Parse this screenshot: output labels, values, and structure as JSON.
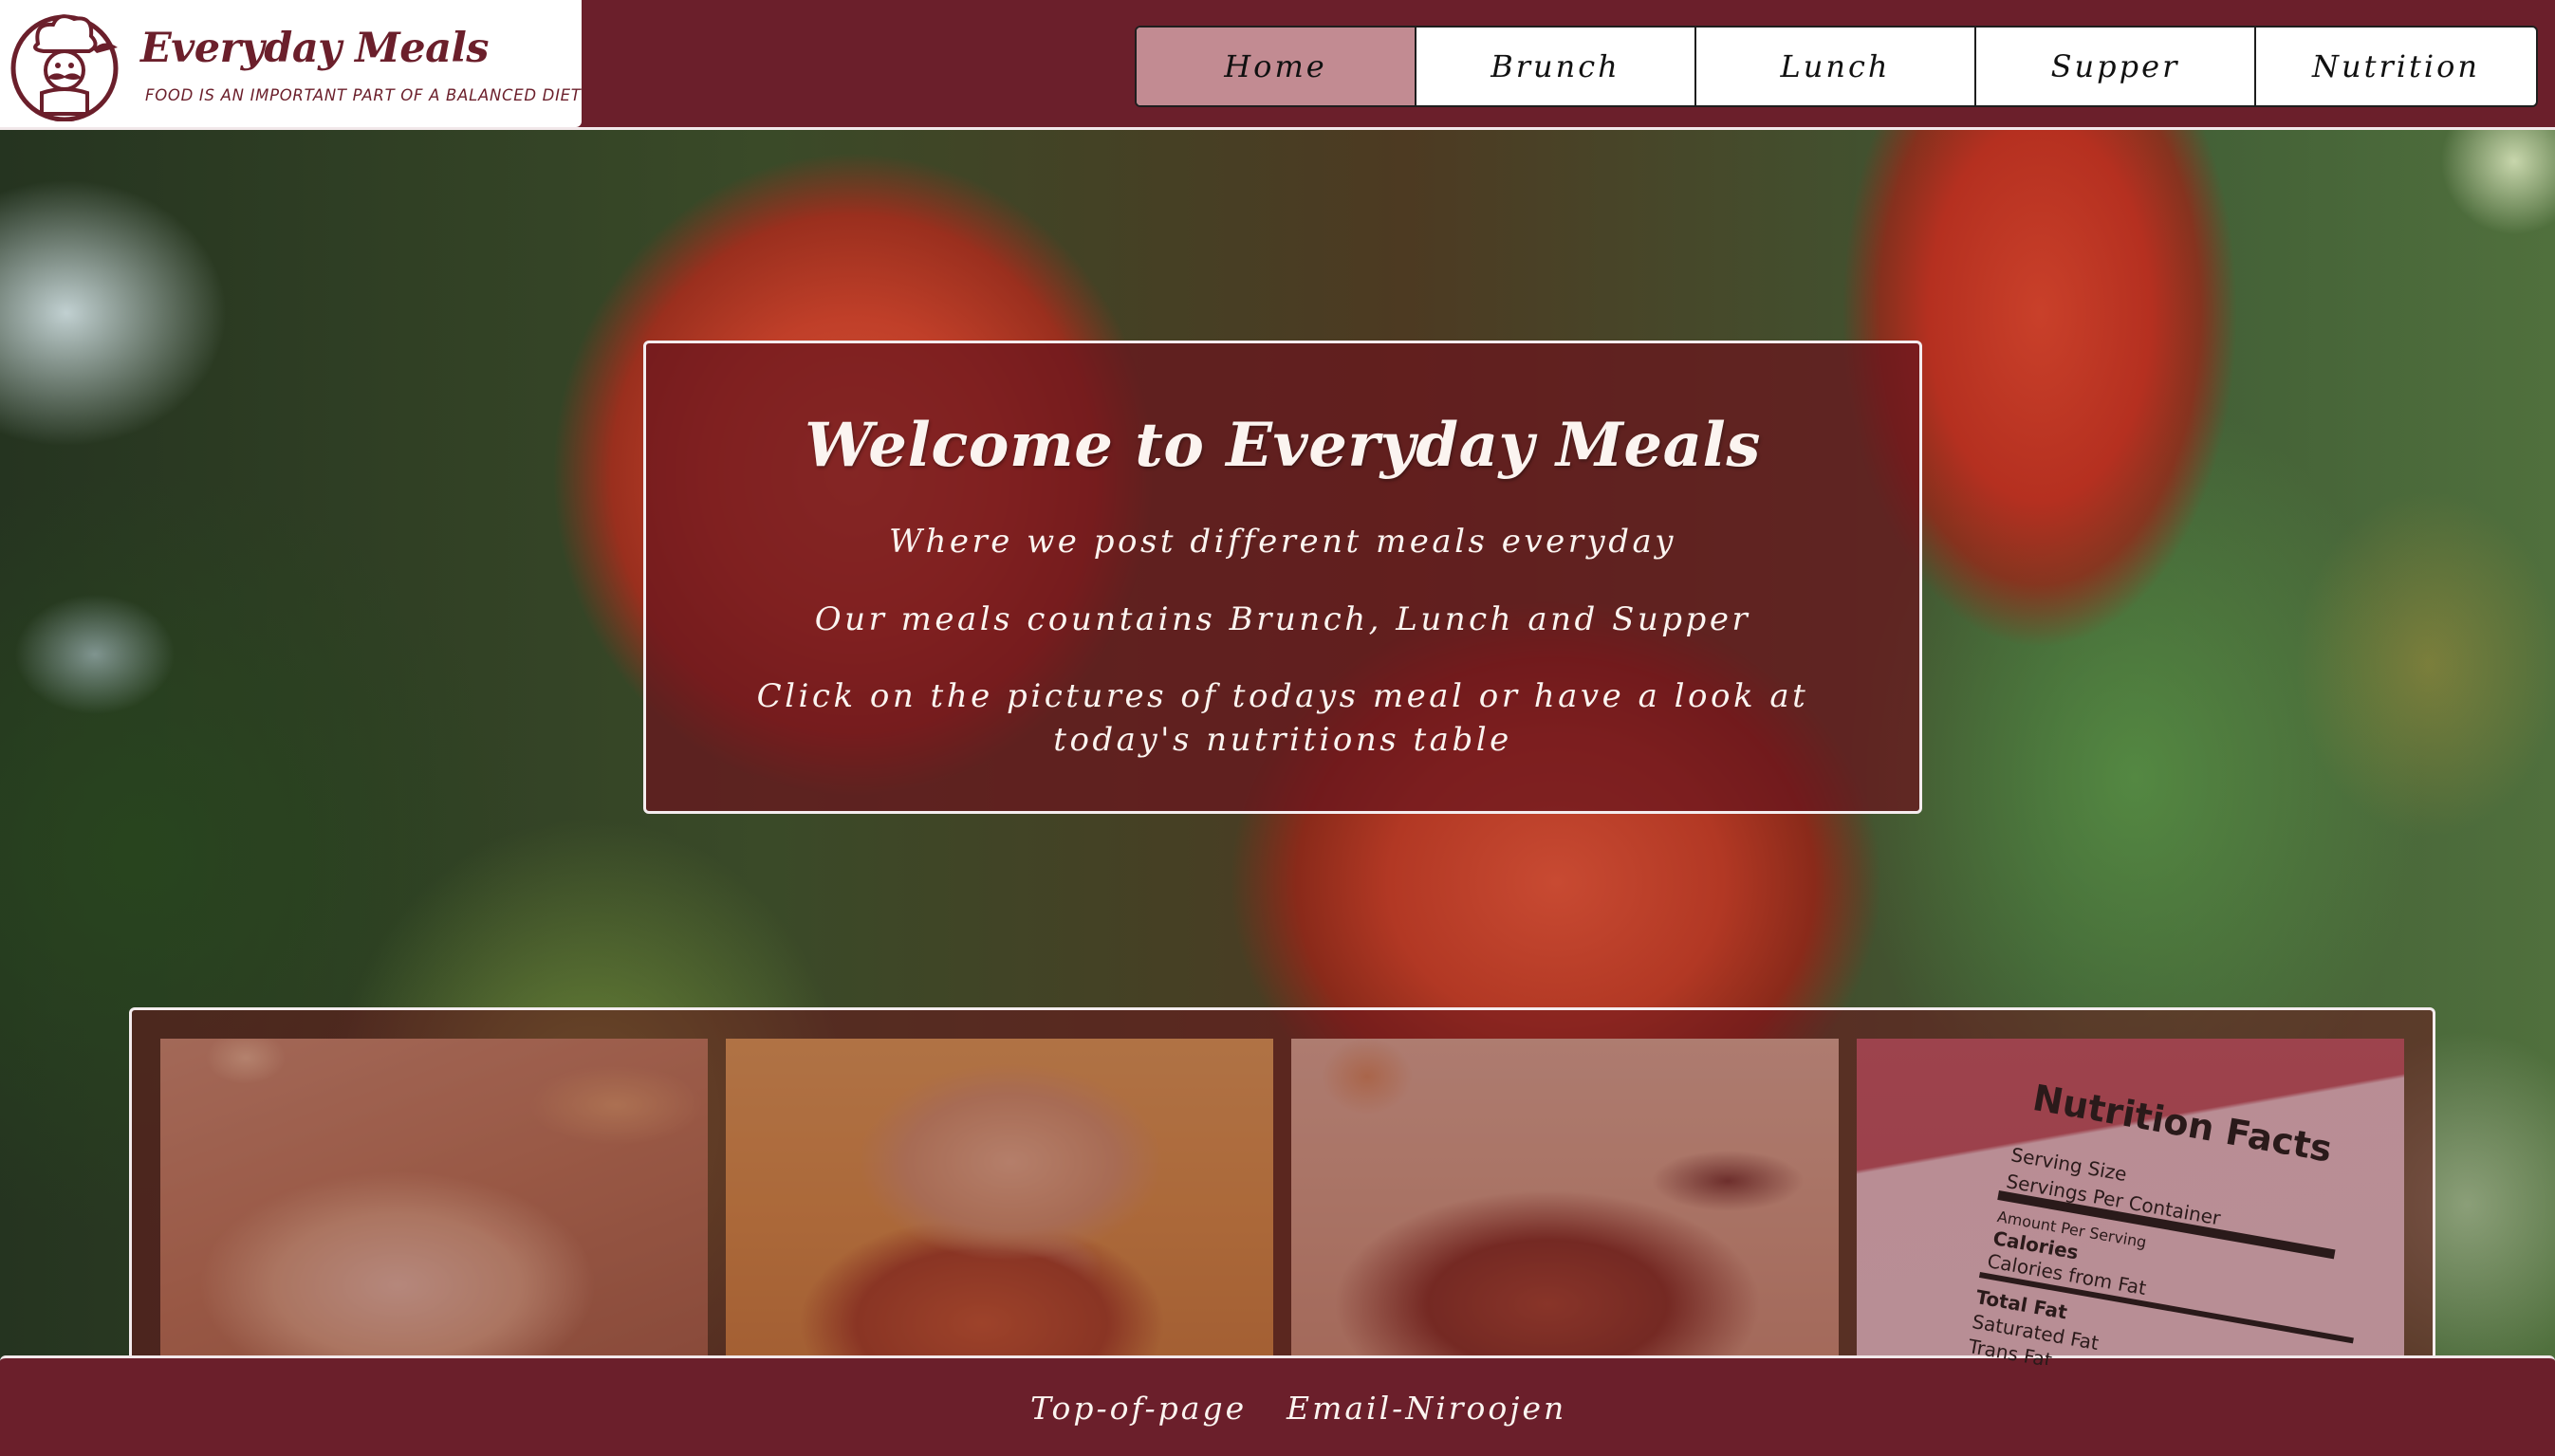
{
  "brand": {
    "name": "Everyday Meals",
    "tagline": "FOOD IS AN IMPORTANT PART OF A BALANCED DIET",
    "logo_icon": "chef-icon",
    "color": "#6b1f2b"
  },
  "nav": {
    "items": [
      {
        "label": "Home",
        "active": true
      },
      {
        "label": "Brunch",
        "active": false
      },
      {
        "label": "Lunch",
        "active": false
      },
      {
        "label": "Supper",
        "active": false
      },
      {
        "label": "Nutrition",
        "active": false
      }
    ],
    "active_color": "#c28b92"
  },
  "welcome": {
    "title": "Welcome to Everyday Meals",
    "line1": "Where we post different meals everyday",
    "line2": "Our meals countains Brunch, Lunch and Supper",
    "line3": "Click on the pictures of todays meal or have a look at today's nutritions table"
  },
  "gallery": {
    "tiles": [
      {
        "name": "brunch-picture"
      },
      {
        "name": "lunch-picture"
      },
      {
        "name": "supper-picture"
      },
      {
        "name": "nutrition-picture"
      }
    ],
    "nutrition_card": {
      "title": "Nutrition Facts",
      "lines": [
        "Serving Size",
        "Servings Per Container",
        "Amount Per Serving",
        "Calories",
        "Calories from Fat",
        "Total Fat",
        "Saturated Fat",
        "Trans Fat"
      ]
    }
  },
  "footer": {
    "links": [
      "Top-of-page",
      "Email-Niroojen"
    ]
  }
}
